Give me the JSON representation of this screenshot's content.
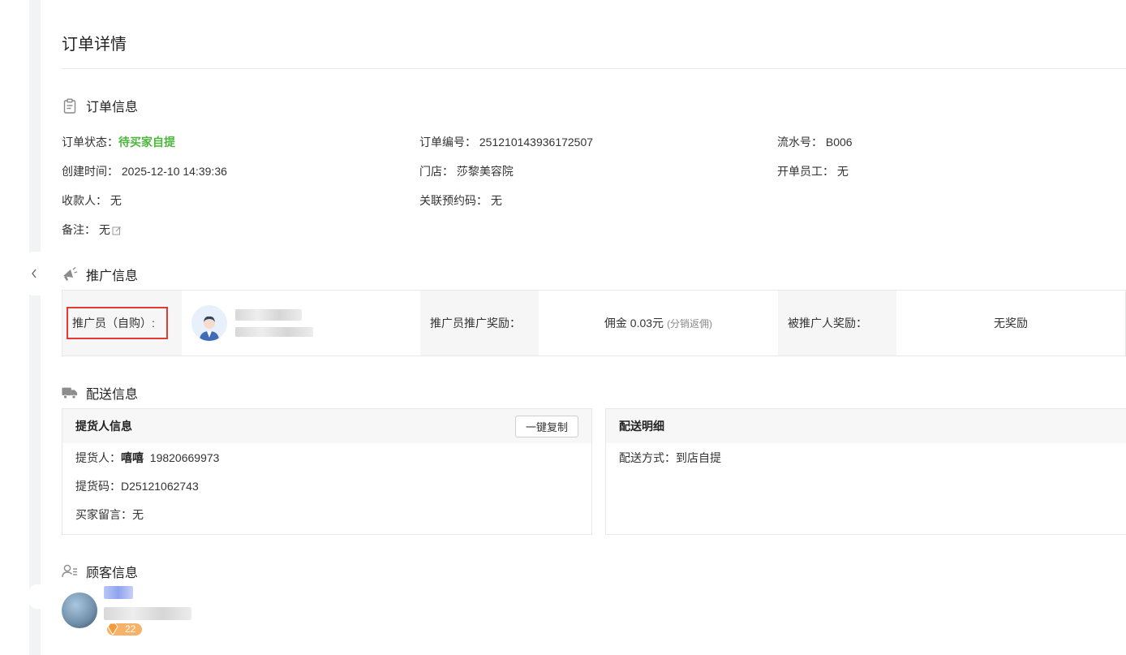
{
  "page": {
    "title": "订单详情"
  },
  "order_info": {
    "section_title": "订单信息",
    "status_label": "订单状态：",
    "status_value": "待买家自提",
    "order_no_label": "订单编号：",
    "order_no_value": "251210143936172507",
    "serial_label": "流水号：",
    "serial_value": "B006",
    "created_label": "创建时间：",
    "created_value": "2025-12-10 14:39:36",
    "store_label": "门店：",
    "store_value": "莎黎美容院",
    "staff_label": "开单员工：",
    "staff_value": "无",
    "payee_label": "收款人：",
    "payee_value": "无",
    "booking_label": "关联预约码：",
    "booking_value": "无",
    "remark_label": "备注：",
    "remark_value": "无"
  },
  "promotion": {
    "section_title": "推广信息",
    "promoter_label": "推广员（自购）:",
    "reward_label": "推广员推广奖励：",
    "reward_value": "佣金 0.03元",
    "reward_note": "(分销返佣)",
    "invitee_label": "被推广人奖励：",
    "invitee_value": "无奖励"
  },
  "delivery": {
    "section_title": "配送信息",
    "pickup_panel_title": "提货人信息",
    "copy_button": "一键复制",
    "picker_label": "提货人：",
    "picker_name": "嘻嘻",
    "picker_phone": "19820669973",
    "pickup_code_label": "提货码：",
    "pickup_code_value": "D25121062743",
    "buyer_msg_label": "买家留言：",
    "buyer_msg_value": "无",
    "detail_panel_title": "配送明细",
    "method_label": "配送方式：",
    "method_value": "到店自提"
  },
  "customer": {
    "section_title": "顾客信息",
    "level_badge": "22"
  },
  "colors": {
    "status_green": "#4db63c",
    "highlight_red": "#e53935",
    "vip_orange": "#f7b267"
  },
  "icons": [
    "chevron-left-icon",
    "clipboard-icon",
    "megaphone-icon",
    "truck-icon",
    "customer-icon",
    "edit-icon",
    "diamond-icon"
  ]
}
